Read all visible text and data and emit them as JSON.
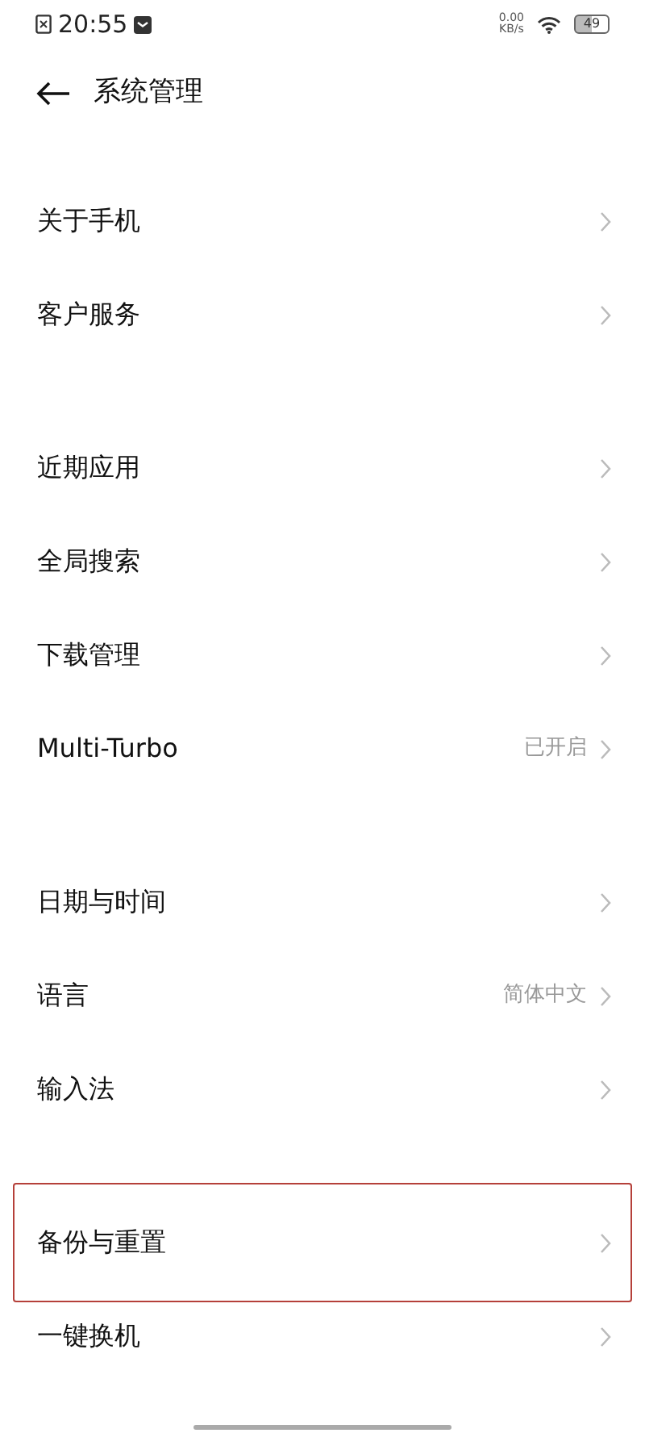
{
  "status_bar": {
    "time": "20:55",
    "net_speed": "0.00",
    "net_unit": "KB/s",
    "battery": "49"
  },
  "header": {
    "title": "系统管理"
  },
  "groups": [
    {
      "items": [
        {
          "label": "关于手机",
          "highlighted": false
        },
        {
          "label": "客户服务",
          "highlighted": false
        }
      ]
    },
    {
      "items": [
        {
          "label": "近期应用",
          "highlighted": false
        },
        {
          "label": "全局搜索",
          "highlighted": false
        },
        {
          "label": "下载管理",
          "highlighted": false
        },
        {
          "label": "Multi-Turbo",
          "value": "已开启",
          "highlighted": false
        }
      ]
    },
    {
      "items": [
        {
          "label": "日期与时间",
          "highlighted": false
        },
        {
          "label": "语言",
          "value": "简体中文",
          "highlighted": false
        },
        {
          "label": "输入法",
          "highlighted": false
        }
      ]
    },
    {
      "items": [
        {
          "label": "备份与重置",
          "highlighted": true
        },
        {
          "label": "一键换机",
          "highlighted": false
        }
      ]
    }
  ]
}
